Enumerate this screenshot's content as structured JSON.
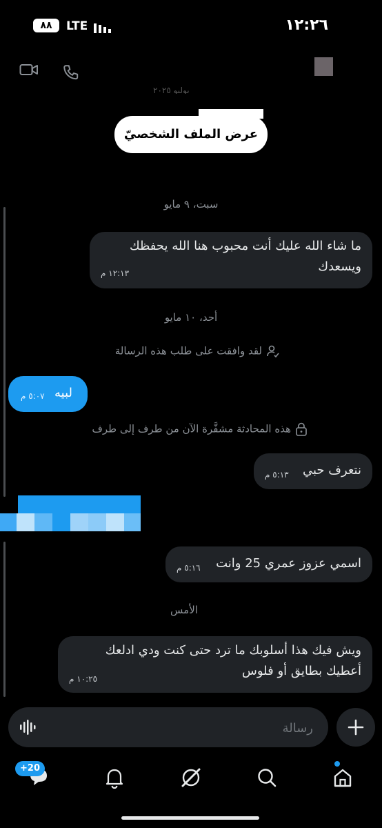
{
  "status_bar": {
    "battery": "٨٨",
    "network": "LTE",
    "time": "١٢:٢٦"
  },
  "header": {
    "faint_text": "يوليو ٢٠٢٥",
    "view_profile": "عرض الملف الشخصيّ"
  },
  "messages": [
    {
      "type": "date",
      "text": "سبت، ٩ مايو"
    },
    {
      "type": "incoming",
      "line1": "ما شاء الله عليك أنت محبوب هنا الله يحفظك",
      "line2": "ويسعدك",
      "time": "١٢:١٣ م"
    },
    {
      "type": "date",
      "text": "أحد، ١٠ مايو"
    },
    {
      "type": "system",
      "text": "لقد وافقت على طلب هذه الرسالة"
    },
    {
      "type": "outgoing",
      "text": "لبيه",
      "time": "٥:٠٧ م"
    },
    {
      "type": "system",
      "text": "هذه المحادثة مشفَّرة الآن من طرف إلى طرف"
    },
    {
      "type": "incoming",
      "text": "نتعرف حبي",
      "time": "٥:١٣ م"
    },
    {
      "type": "incoming",
      "text": "اسمي عزوز عمري 25 وانت",
      "time": "٥:١٦ م"
    },
    {
      "type": "date",
      "text": "الأمس"
    },
    {
      "type": "incoming",
      "line1": "ويش فيك هذا أسلوبك ما ترد حتى كنت ودي ادلعك",
      "line2": "أعطيك بطايق أو فلوس",
      "time": "١٠:٢٥ م"
    }
  ],
  "composer": {
    "placeholder": "رسالة"
  },
  "nav": {
    "badge": "+20"
  },
  "colors": {
    "accent": "#1d9bf0",
    "bubble_incoming": "#202327",
    "background": "#000000"
  },
  "icons": [
    "video-icon",
    "phone-icon",
    "voice-icon",
    "plus-icon",
    "messages-icon",
    "bell-icon",
    "grok-icon",
    "search-icon",
    "home-icon",
    "person-check-icon",
    "lock-icon"
  ]
}
